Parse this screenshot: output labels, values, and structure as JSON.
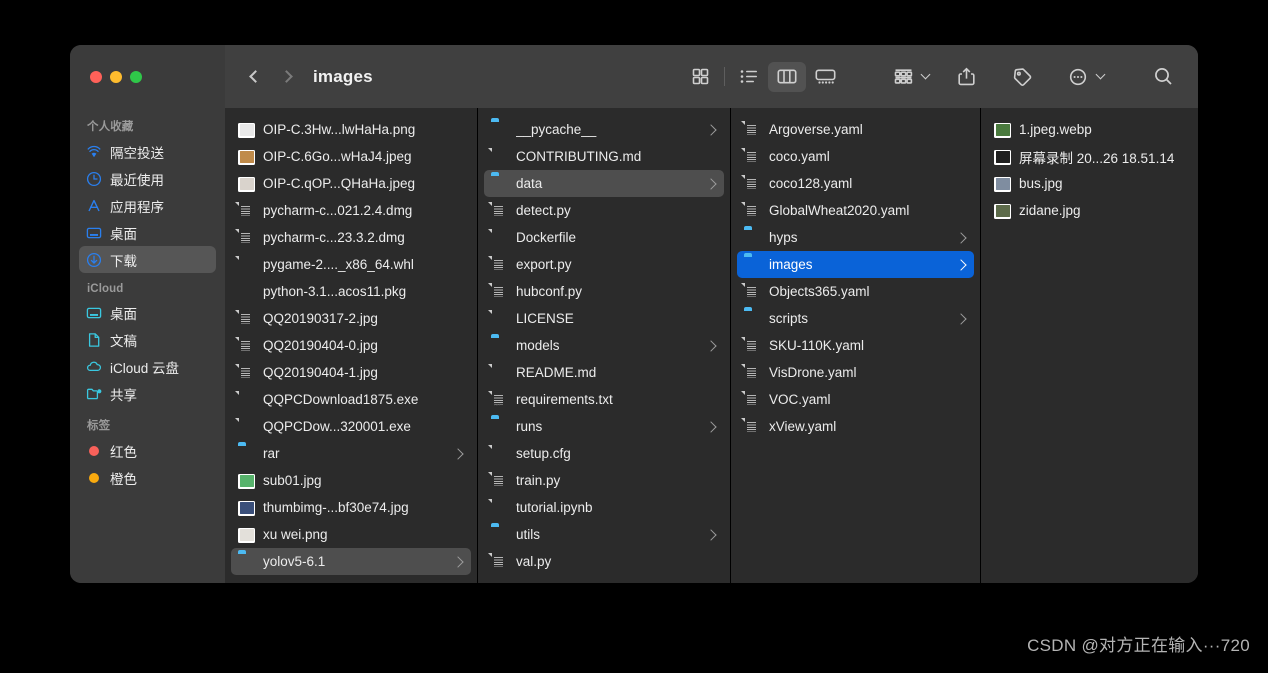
{
  "window": {
    "title": "images",
    "traffic_lights": [
      {
        "name": "close",
        "color": "#ff6159"
      },
      {
        "name": "minimize",
        "color": "#febc2e"
      },
      {
        "name": "maximize",
        "color": "#2fc749"
      }
    ]
  },
  "toolbar": {
    "back_label": "Back",
    "forward_label": "Forward",
    "view_icon_grid": "grid-view-icon",
    "view_icon_list": "list-view-icon",
    "view_icon_column": "column-view-icon",
    "view_icon_gallery": "gallery-view-icon",
    "active_view": "column",
    "group_label": "group-by-icon",
    "share_label": "share-icon",
    "tag_label": "tag-icon",
    "more_label": "more-actions-icon",
    "search_label": "search-icon"
  },
  "sidebar": {
    "sections": [
      {
        "header": "个人收藏",
        "items": [
          {
            "label": "隔空投送",
            "icon": "airdrop-icon",
            "color": "#2a7fee",
            "selected": false
          },
          {
            "label": "最近使用",
            "icon": "clock-icon",
            "color": "#2a7fee",
            "selected": false
          },
          {
            "label": "应用程序",
            "icon": "applications-icon",
            "color": "#2a7fee",
            "selected": false
          },
          {
            "label": "桌面",
            "icon": "desktop-icon",
            "color": "#2a7fee",
            "selected": false
          },
          {
            "label": "下载",
            "icon": "downloads-icon",
            "color": "#2a7fee",
            "selected": true
          }
        ]
      },
      {
        "header": "iCloud",
        "items": [
          {
            "label": "桌面",
            "icon": "desktop-icon",
            "color": "#3ac8e0",
            "selected": false
          },
          {
            "label": "文稿",
            "icon": "document-icon",
            "color": "#3ac8e0",
            "selected": false
          },
          {
            "label": "iCloud 云盘",
            "icon": "cloud-icon",
            "color": "#3ac8e0",
            "selected": false
          },
          {
            "label": "共享",
            "icon": "shared-folder-icon",
            "color": "#3ac8e0",
            "selected": false
          }
        ]
      },
      {
        "header": "标签",
        "items": [
          {
            "label": "红色",
            "icon": "tag-dot-icon",
            "color": "#f8615a",
            "selected": false
          },
          {
            "label": "橙色",
            "icon": "tag-dot-icon",
            "color": "#f9aa0f",
            "selected": false
          }
        ]
      }
    ]
  },
  "columns": [
    {
      "name": "downloads-column",
      "items": [
        {
          "label": "OIP-C.3Hw...lwHaHa.png",
          "type": "image",
          "arrow": false,
          "selected": false,
          "swatch": "#e8e8e8"
        },
        {
          "label": "OIP-C.6Go...wHaJ4.jpeg",
          "type": "image",
          "arrow": false,
          "selected": false,
          "swatch": "#c08b4a"
        },
        {
          "label": "OIP-C.qOP...QHaHa.jpeg",
          "type": "image",
          "arrow": false,
          "selected": false,
          "swatch": "#d9d3cc"
        },
        {
          "label": "pycharm-c...021.2.4.dmg",
          "type": "doc-lined",
          "arrow": false,
          "selected": false
        },
        {
          "label": "pycharm-c...23.3.2.dmg",
          "type": "doc-lined",
          "arrow": false,
          "selected": false
        },
        {
          "label": "pygame-2...._x86_64.whl",
          "type": "doc",
          "arrow": false,
          "selected": false
        },
        {
          "label": "python-3.1...acos11.pkg",
          "type": "pkg",
          "arrow": false,
          "selected": false
        },
        {
          "label": "QQ20190317-2.jpg",
          "type": "doc-lined",
          "arrow": false,
          "selected": false
        },
        {
          "label": "QQ20190404-0.jpg",
          "type": "doc-lined",
          "arrow": false,
          "selected": false
        },
        {
          "label": "QQ20190404-1.jpg",
          "type": "doc-lined",
          "arrow": false,
          "selected": false
        },
        {
          "label": "QQPCDownload1875.exe",
          "type": "doc",
          "arrow": false,
          "selected": false
        },
        {
          "label": "QQPCDow...320001.exe",
          "type": "doc",
          "arrow": false,
          "selected": false
        },
        {
          "label": "rar",
          "type": "folder",
          "arrow": true,
          "selected": false
        },
        {
          "label": "sub01.jpg",
          "type": "image",
          "arrow": false,
          "selected": false,
          "swatch": "#57b36c"
        },
        {
          "label": "thumbimg-...bf30e74.jpg",
          "type": "image",
          "arrow": false,
          "selected": false,
          "swatch": "#3a4f7a"
        },
        {
          "label": "xu wei.png",
          "type": "image",
          "arrow": false,
          "selected": false,
          "swatch": "#e3e0da"
        },
        {
          "label": "yolov5-6.1",
          "type": "folder",
          "arrow": true,
          "selected": "grey"
        }
      ]
    },
    {
      "name": "yolov5-column",
      "items": [
        {
          "label": "__pycache__",
          "type": "folder",
          "arrow": true,
          "selected": false
        },
        {
          "label": "CONTRIBUTING.md",
          "type": "doc",
          "arrow": false,
          "selected": false
        },
        {
          "label": "data",
          "type": "folder",
          "arrow": true,
          "selected": "grey"
        },
        {
          "label": "detect.py",
          "type": "doc-lined",
          "arrow": false,
          "selected": false
        },
        {
          "label": "Dockerfile",
          "type": "doc",
          "arrow": false,
          "selected": false
        },
        {
          "label": "export.py",
          "type": "doc-lined",
          "arrow": false,
          "selected": false
        },
        {
          "label": "hubconf.py",
          "type": "doc-lined",
          "arrow": false,
          "selected": false
        },
        {
          "label": "LICENSE",
          "type": "doc",
          "arrow": false,
          "selected": false
        },
        {
          "label": "models",
          "type": "folder",
          "arrow": true,
          "selected": false
        },
        {
          "label": "README.md",
          "type": "doc",
          "arrow": false,
          "selected": false
        },
        {
          "label": "requirements.txt",
          "type": "doc-txt",
          "arrow": false,
          "selected": false
        },
        {
          "label": "runs",
          "type": "folder",
          "arrow": true,
          "selected": false
        },
        {
          "label": "setup.cfg",
          "type": "doc",
          "arrow": false,
          "selected": false
        },
        {
          "label": "train.py",
          "type": "doc-lined",
          "arrow": false,
          "selected": false
        },
        {
          "label": "tutorial.ipynb",
          "type": "doc",
          "arrow": false,
          "selected": false
        },
        {
          "label": "utils",
          "type": "folder",
          "arrow": true,
          "selected": false
        },
        {
          "label": "val.py",
          "type": "doc-lined",
          "arrow": false,
          "selected": false
        }
      ]
    },
    {
      "name": "data-column",
      "items": [
        {
          "label": "Argoverse.yaml",
          "type": "doc-lined",
          "arrow": false,
          "selected": false
        },
        {
          "label": "coco.yaml",
          "type": "doc-lined",
          "arrow": false,
          "selected": false
        },
        {
          "label": "coco128.yaml",
          "type": "doc-lined",
          "arrow": false,
          "selected": false
        },
        {
          "label": "GlobalWheat2020.yaml",
          "type": "doc-lined",
          "arrow": false,
          "selected": false
        },
        {
          "label": "hyps",
          "type": "folder",
          "arrow": true,
          "selected": false
        },
        {
          "label": "images",
          "type": "folder",
          "arrow": true,
          "selected": "blue"
        },
        {
          "label": "Objects365.yaml",
          "type": "doc-lined",
          "arrow": false,
          "selected": false
        },
        {
          "label": "scripts",
          "type": "folder",
          "arrow": true,
          "selected": false
        },
        {
          "label": "SKU-110K.yaml",
          "type": "doc-lined",
          "arrow": false,
          "selected": false
        },
        {
          "label": "VisDrone.yaml",
          "type": "doc-lined",
          "arrow": false,
          "selected": false
        },
        {
          "label": "VOC.yaml",
          "type": "doc-lined",
          "arrow": false,
          "selected": false
        },
        {
          "label": "xView.yaml",
          "type": "doc-lined",
          "arrow": false,
          "selected": false
        }
      ]
    },
    {
      "name": "images-column",
      "items": [
        {
          "label": "1.jpeg.webp",
          "type": "image",
          "arrow": false,
          "selected": false,
          "swatch": "#4a7a3e"
        },
        {
          "label": "屏幕录制 20...26 18.51.14",
          "type": "image",
          "arrow": false,
          "selected": false,
          "swatch": "#1f1f1f"
        },
        {
          "label": "bus.jpg",
          "type": "image",
          "arrow": false,
          "selected": false,
          "swatch": "#7f8da0"
        },
        {
          "label": "zidane.jpg",
          "type": "image",
          "arrow": false,
          "selected": false,
          "swatch": "#5d6b4a"
        }
      ]
    }
  ],
  "watermark": {
    "text": "CSDN @对方正在输入···720"
  }
}
